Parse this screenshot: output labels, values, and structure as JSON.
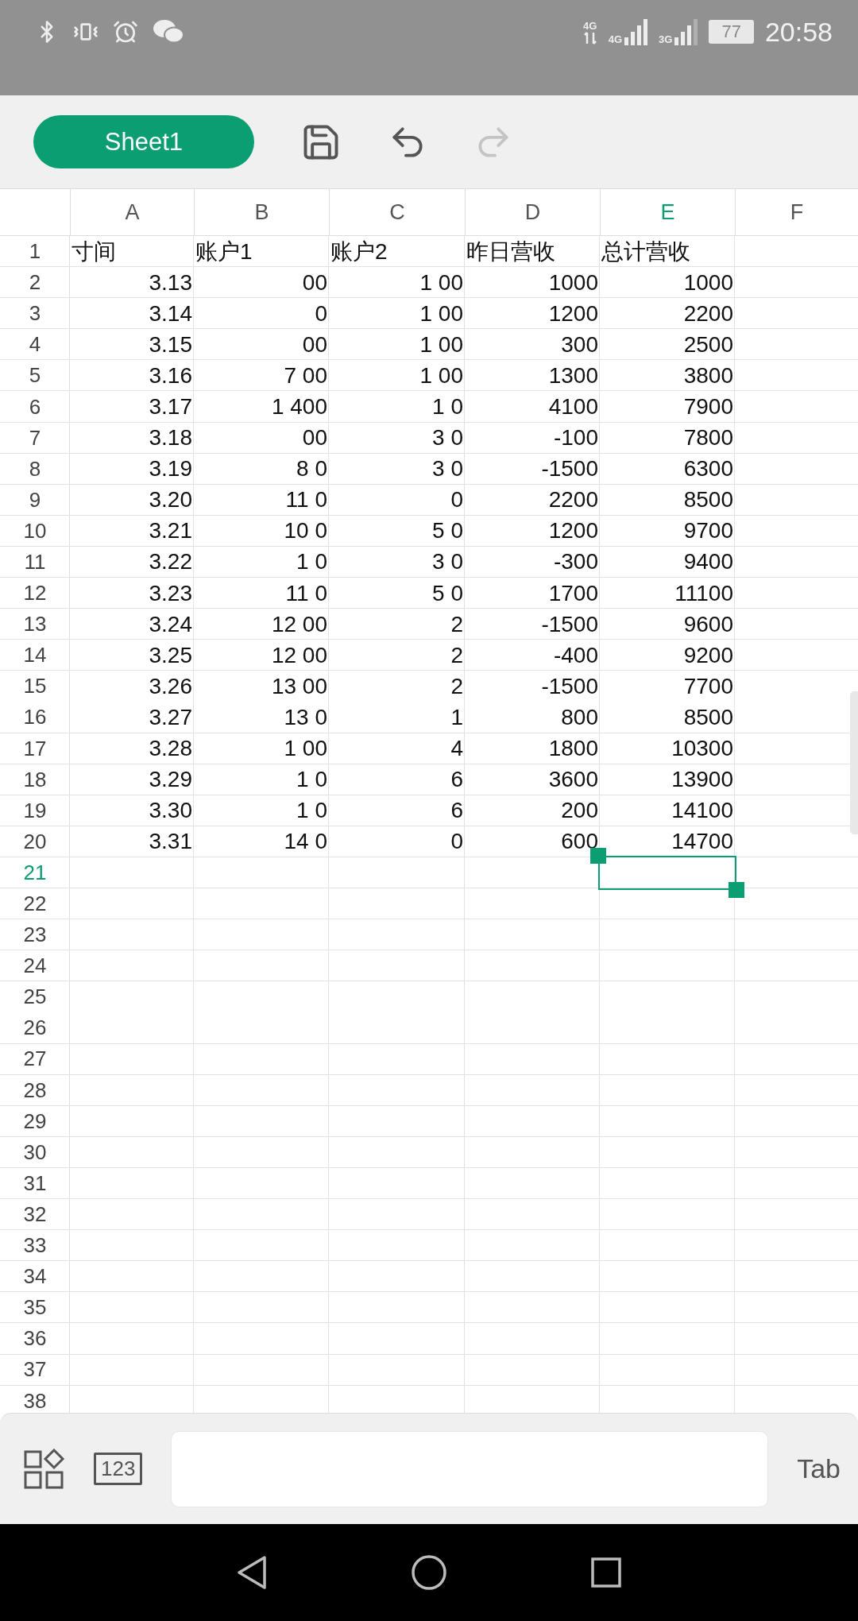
{
  "status_bar": {
    "networks": [
      {
        "label": "4G",
        "kind": "data"
      },
      {
        "label": "4G",
        "kind": "signal"
      },
      {
        "label": "3G",
        "kind": "signal"
      }
    ],
    "battery": "77",
    "time": "20:58"
  },
  "toolbar": {
    "sheet_tab": "Sheet1",
    "redo_disabled": true
  },
  "columns": [
    {
      "label": "A",
      "selected": false
    },
    {
      "label": "B",
      "selected": false
    },
    {
      "label": "C",
      "selected": false
    },
    {
      "label": "D",
      "selected": false
    },
    {
      "label": "E",
      "selected": true
    },
    {
      "label": "F",
      "selected": false
    }
  ],
  "rows": [
    {
      "number": "1",
      "selected": false,
      "cells": [
        "寸间",
        "账户1",
        "账户2",
        "昨日营收",
        "总计营收"
      ]
    },
    {
      "number": "2",
      "selected": false,
      "cells": [
        "3.13",
        "00",
        "1 00",
        "1000",
        "1000"
      ]
    },
    {
      "number": "3",
      "selected": false,
      "cells": [
        "3.14",
        "0",
        "1 00",
        "1200",
        "2200"
      ]
    },
    {
      "number": "4",
      "selected": false,
      "cells": [
        "3.15",
        "00",
        "1 00",
        "300",
        "2500"
      ]
    },
    {
      "number": "5",
      "selected": false,
      "cells": [
        "3.16",
        "7 00",
        "1 00",
        "1300",
        "3800"
      ]
    },
    {
      "number": "6",
      "selected": false,
      "cells": [
        "3.17",
        "1 400",
        "1 0",
        "4100",
        "7900"
      ]
    },
    {
      "number": "7",
      "selected": false,
      "cells": [
        "3.18",
        "00",
        "3 0",
        "-100",
        "7800"
      ]
    },
    {
      "number": "8",
      "selected": false,
      "cells": [
        "3.19",
        "8 0",
        "3 0",
        "-1500",
        "6300"
      ]
    },
    {
      "number": "9",
      "selected": false,
      "cells": [
        "3.20",
        "11 0",
        "0",
        "2200",
        "8500"
      ]
    },
    {
      "number": "10",
      "selected": false,
      "cells": [
        "3.21",
        "10 0",
        "5 0",
        "1200",
        "9700"
      ]
    },
    {
      "number": "11",
      "selected": false,
      "cells": [
        "3.22",
        "1 0",
        "3 0",
        "-300",
        "9400"
      ]
    },
    {
      "number": "12",
      "selected": false,
      "cells": [
        "3.23",
        "11 0",
        "5 0",
        "1700",
        "11100"
      ]
    },
    {
      "number": "13",
      "selected": false,
      "cells": [
        "3.24",
        "12 00",
        "2",
        "-1500",
        "9600"
      ]
    },
    {
      "number": "14",
      "selected": false,
      "cells": [
        "3.25",
        "12 00",
        "2",
        "-400",
        "9200"
      ]
    },
    {
      "number": "15",
      "selected": false,
      "cells": [
        "3.26",
        "13 00",
        "2",
        "-1500",
        "7700"
      ]
    },
    {
      "number": "16",
      "selected": false,
      "cells": [
        "3.27",
        "13 0",
        "1",
        "800",
        "8500"
      ]
    },
    {
      "number": "17",
      "selected": false,
      "cells": [
        "3.28",
        "1 00",
        "4",
        "1800",
        "10300"
      ]
    },
    {
      "number": "18",
      "selected": false,
      "cells": [
        "3.29",
        "1 0",
        "6",
        "3600",
        "13900"
      ]
    },
    {
      "number": "19",
      "selected": false,
      "cells": [
        "3.30",
        "1 0",
        "6",
        "200",
        "14100"
      ]
    },
    {
      "number": "20",
      "selected": false,
      "cells": [
        "3.31",
        "14 0",
        "0",
        "600",
        "14700"
      ]
    },
    {
      "number": "21",
      "selected": true
    },
    {
      "number": "22",
      "selected": false
    },
    {
      "number": "23",
      "selected": false
    },
    {
      "number": "24",
      "selected": false
    },
    {
      "number": "25",
      "selected": false
    },
    {
      "number": "26",
      "selected": false
    },
    {
      "number": "27",
      "selected": false
    },
    {
      "number": "28",
      "selected": false
    },
    {
      "number": "29",
      "selected": false
    },
    {
      "number": "30",
      "selected": false
    },
    {
      "number": "31",
      "selected": false
    },
    {
      "number": "32",
      "selected": false
    },
    {
      "number": "33",
      "selected": false
    },
    {
      "number": "34",
      "selected": false
    },
    {
      "number": "35",
      "selected": false
    },
    {
      "number": "36",
      "selected": false
    },
    {
      "number": "37",
      "selected": false
    },
    {
      "number": "38",
      "selected": false
    }
  ],
  "input_bar": {
    "numeric_key": "123",
    "tab_key": "Tab"
  }
}
